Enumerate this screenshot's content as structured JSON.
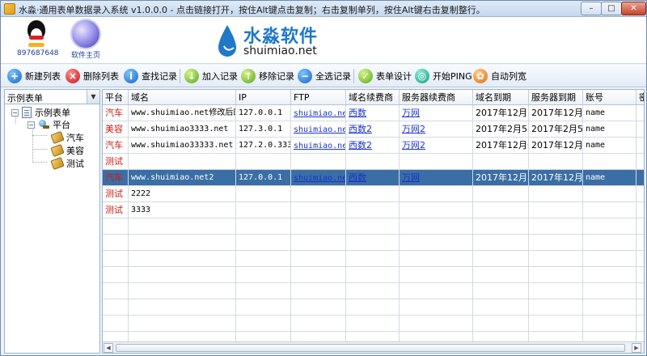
{
  "window": {
    "title": "水淼·通用表单数据录入系统 v1.0.0.0 - 点击链接打开，按住Alt键点击复制；右击复制单列，按住Alt键右击复制整行。",
    "min_label": "–",
    "max_label": "□",
    "close_label": "✕"
  },
  "banner": {
    "qq_number": "897687648",
    "home_label": "软件主页",
    "logo_cn": "水淼软件",
    "logo_en": "shuimiao.net"
  },
  "toolbar": {
    "new_list": "新建列表",
    "delete_list": "删除列表",
    "find_record": "查找记录",
    "add_record": "加入记录",
    "remove_record": "移除记录",
    "select_all": "全选记录",
    "form_design": "表单设计",
    "start_ping": "开始PING",
    "auto_width": "自动列宽"
  },
  "sidebar": {
    "combo_value": "示例表单",
    "root_label": "示例表单",
    "platform_label": "平台",
    "children": [
      "汽车",
      "美容",
      "测试"
    ]
  },
  "grid": {
    "columns": [
      "平台",
      "域名",
      "IP",
      "FTP",
      "域名续费商",
      "服务器续费商",
      "域名到期",
      "服务器到期",
      "账号",
      "密"
    ],
    "rows": [
      [
        "汽车",
        "www.shuimiao.net修改后的",
        "127.0.0.1",
        "shuimiao.ne…",
        "西数",
        "万网",
        "2017年12月7…",
        "2017年12月7…",
        "name",
        ""
      ],
      [
        "美容",
        "www.shuimiao3333.net",
        "127.3.0.1",
        "shuimiao.ne…",
        "西数2",
        "万网2",
        "2017年2月5…",
        "2017年2月5…",
        "name",
        ""
      ],
      [
        "汽车",
        "www.shuimiao33333.net",
        "127.2.0.333",
        "shuimiao.ne…",
        "西数2",
        "万网2",
        "2017年12月6…",
        "2017年12月6…",
        "name",
        ""
      ],
      [
        "测试",
        "",
        "",
        "",
        "",
        "",
        "",
        "",
        "",
        ""
      ],
      [
        "汽车",
        "www.shuimiao.net2",
        "127.0.0.1",
        "shuimiao.ne…",
        "西数",
        "万网",
        "2017年12月7…",
        "2017年12月7…",
        "name",
        ""
      ],
      [
        "测试",
        "2222",
        "",
        "",
        "",
        "",
        "",
        "",
        "",
        ""
      ],
      [
        "测试",
        "3333",
        "",
        "",
        "",
        "",
        "",
        "",
        "",
        ""
      ]
    ],
    "selected_row": 4,
    "empty_rows": 8
  }
}
